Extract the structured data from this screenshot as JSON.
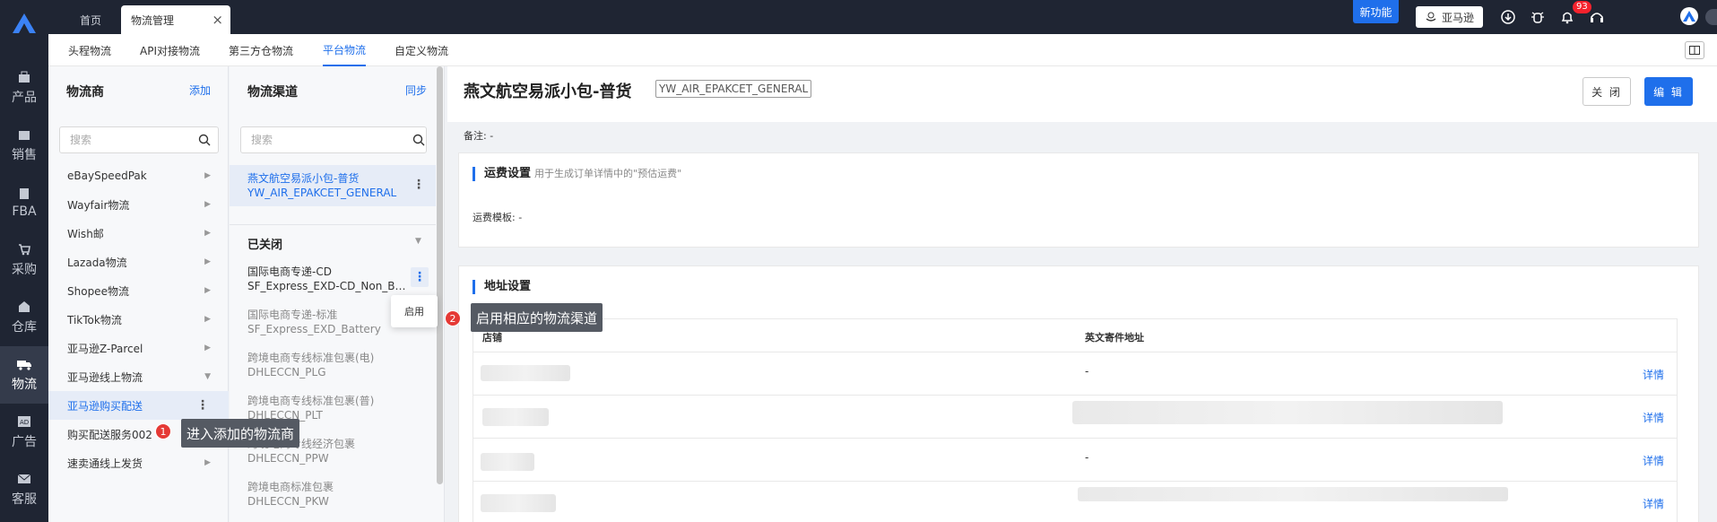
{
  "rail": {
    "items": [
      {
        "label": "产品",
        "icon": "product-icon"
      },
      {
        "label": "销售",
        "icon": "sales-icon"
      },
      {
        "label": "FBA",
        "icon": "fba-icon"
      },
      {
        "label": "采购",
        "icon": "purchase-icon"
      },
      {
        "label": "仓库",
        "icon": "warehouse-icon"
      },
      {
        "label": "物流",
        "icon": "logistics-icon"
      },
      {
        "label": "广告",
        "icon": "ad-icon"
      },
      {
        "label": "客服",
        "icon": "service-icon"
      }
    ],
    "active_index": 5
  },
  "topbar": {
    "tab_home": "首页",
    "tab_logistics": "物流管理",
    "new_feature": "新功能",
    "amazon_button": "亚马逊",
    "notification_count": "93"
  },
  "subnav": {
    "items": [
      "头程物流",
      "API对接物流",
      "第三方仓物流",
      "平台物流",
      "自定义物流"
    ],
    "active": "平台物流"
  },
  "carriers": {
    "title": "物流商",
    "add_label": "添加",
    "search_placeholder": "搜索",
    "items": [
      {
        "label": "eBaySpeedPak"
      },
      {
        "label": "Wayfair物流"
      },
      {
        "label": "Wish邮"
      },
      {
        "label": "Lazada物流"
      },
      {
        "label": "Shopee物流"
      },
      {
        "label": "TikTok物流"
      },
      {
        "label": "亚马逊Z-Parcel"
      },
      {
        "label": "亚马逊线上物流"
      },
      {
        "label": "亚马逊购买配送"
      },
      {
        "label": "购买配送服务002"
      },
      {
        "label": "速卖通线上发货"
      }
    ]
  },
  "channels": {
    "title": "物流渠道",
    "sync_label": "同步",
    "search_placeholder": "搜索",
    "active": {
      "name": "燕文航空易派小包-普货",
      "code": "YW_AIR_EPAKCET_GENERAL"
    },
    "closed_header": "已关闭",
    "closed_items": [
      {
        "name": "国际电商专递-CD",
        "code": "SF_Express_EXD-CD_Non_Battery"
      },
      {
        "name": "国际电商专递-标准",
        "code": "SF_Express_EXD_Battery"
      },
      {
        "name": "跨境电商专线标准包裹(电)",
        "code": "DHLECCN_PLG"
      },
      {
        "name": "跨境电商专线标准包裹(普)",
        "code": "DHLECCN_PLT"
      },
      {
        "name": "跨境电商专线经济包裹",
        "code": "DHLECCN_PPW"
      },
      {
        "name": "跨境电商标准包裹",
        "code": "DHLECCN_PKW"
      }
    ],
    "popup_enable": "启用"
  },
  "callouts": {
    "one_num": "1",
    "one_text": "进入添加的物流商",
    "two_num": "2",
    "two_text": "启用相应的物流渠道"
  },
  "detail": {
    "title": "燕文航空易派小包-普货",
    "code": "YW_AIR_EPAKCET_GENERAL",
    "close_label": "关 闭",
    "edit_label": "编 辑",
    "remark": "备注: -",
    "freight": {
      "title": "运费设置",
      "hint": "用于生成订单详情中的\"预估运费\"",
      "template": "运费模板: -"
    },
    "address": {
      "title": "地址设置",
      "col_store": "店铺",
      "col_address": "英文寄件地址",
      "rows": [
        {
          "address": "-",
          "link": "详情"
        },
        {
          "address": "",
          "link": "详情"
        },
        {
          "address": "-",
          "link": "详情"
        },
        {
          "address": "",
          "link": "详情"
        }
      ]
    }
  }
}
